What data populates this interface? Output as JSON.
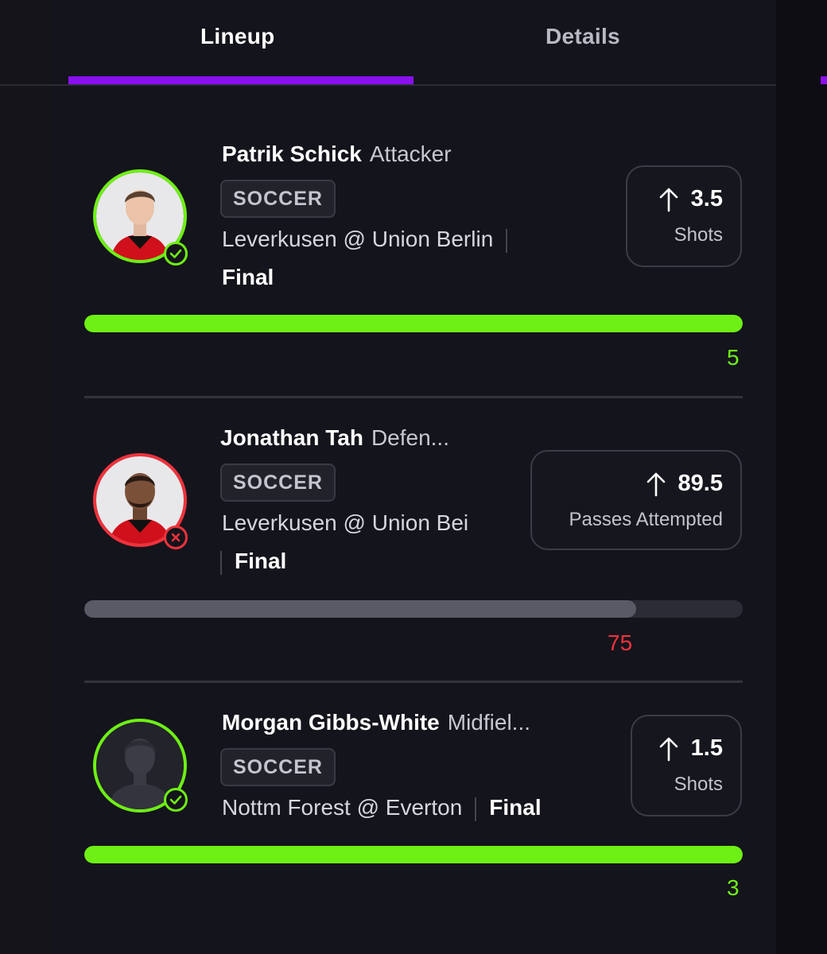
{
  "tabs": [
    {
      "label": "Lineup",
      "active": true
    },
    {
      "label": "Details",
      "active": false
    }
  ],
  "colors": {
    "accent": "#8a10f0",
    "hit": "#6ef014",
    "miss": "#f0323c"
  },
  "picks": [
    {
      "name": "Patrik Schick",
      "position": "Attacker",
      "sport": "SOCCER",
      "game": "Leverkusen @ Union Berlin",
      "status": "Final",
      "line": "3.5",
      "stat": "Shots",
      "direction": "over",
      "result_icon": "check-icon",
      "actual": "5",
      "progress": 1.0
    },
    {
      "name": "Jonathan Tah",
      "position": "Defen...",
      "sport": "SOCCER",
      "game": "Leverkusen @ Union Bei",
      "status": "Final",
      "line": "89.5",
      "stat": "Passes Attempted",
      "direction": "over",
      "result_icon": "x-icon",
      "actual": "75",
      "progress": 0.838
    },
    {
      "name": "Morgan Gibbs-White",
      "position": "Midfiel...",
      "sport": "SOCCER",
      "game": "Nottm Forest @ Everton",
      "status": "Final",
      "line": "1.5",
      "stat": "Shots",
      "direction": "over",
      "result_icon": "check-icon",
      "actual": "3",
      "progress": 1.0
    }
  ]
}
